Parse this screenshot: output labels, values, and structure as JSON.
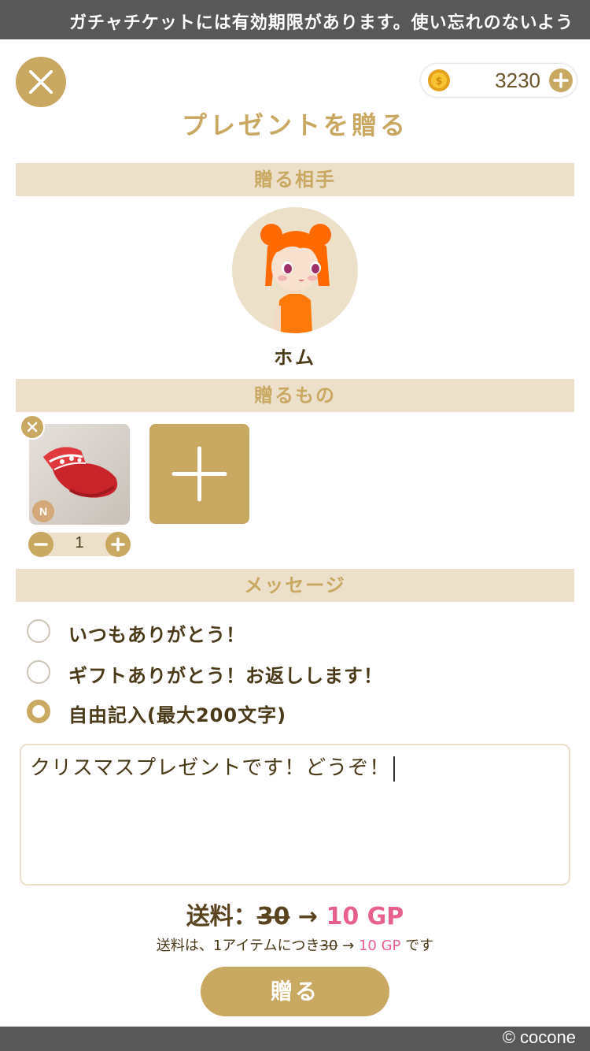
{
  "ticker": {
    "text": "ガチャチケットには有効期限があります。使い忘れのないよう"
  },
  "header": {
    "title": "プレゼントを贈る",
    "coins": "3230"
  },
  "sections": {
    "recipient": "贈る相手",
    "gift": "贈るもの",
    "message": "メッセージ"
  },
  "recipient": {
    "name": "ホム"
  },
  "gift": {
    "rarity": "N",
    "quantity": "1"
  },
  "message": {
    "options": [
      "いつもありがとう！",
      "ギフトありがとう！お返しします！",
      "自由記入(最大200文字)"
    ],
    "selected_index": 2,
    "text": "クリスマスプレゼントです！どうぞ！"
  },
  "fee": {
    "label": "送料：",
    "old": "30",
    "arrow": "→",
    "new": "10 GP",
    "note_prefix": "送料は、1アイテムにつき",
    "note_old": "30",
    "note_arrow": "→",
    "note_new": "10 GP",
    "note_suffix": "です"
  },
  "send_label": "贈る",
  "footer": {
    "copyright": "© cocone"
  },
  "colors": {
    "gold": "#c9a861",
    "band": "#ede0cb",
    "pink": "#e8608c",
    "text": "#4a3a18"
  },
  "icons": {
    "close": "close-icon",
    "coin": "coin-icon",
    "plus": "plus-icon",
    "minus": "minus-icon"
  }
}
